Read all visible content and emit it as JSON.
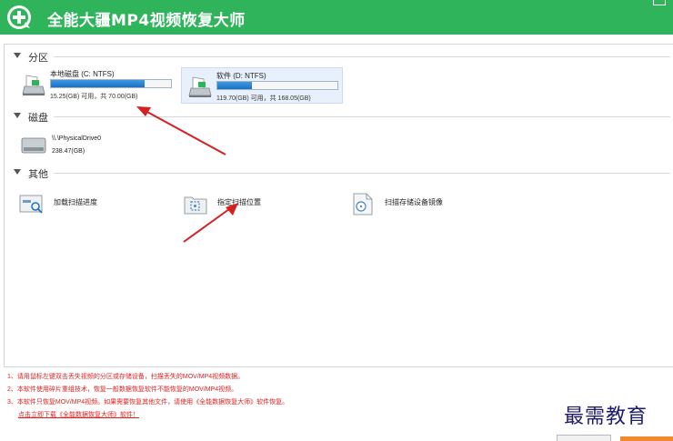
{
  "app": {
    "title": "全能大疆MP4视频恢复大师"
  },
  "sections": {
    "partition": {
      "label": "分区"
    },
    "disk": {
      "label": "磁盘"
    },
    "other": {
      "label": "其他"
    }
  },
  "partitions": [
    {
      "name": "本地磁盘 (C: NTFS)",
      "usage": "15.25(GB) 可用，共 70.00(GB)",
      "used_fraction": 0.78
    },
    {
      "name": "软件 (D: NTFS)",
      "usage": "119.70(GB) 可用，共 168.05(GB)",
      "used_fraction": 0.29
    }
  ],
  "disks": [
    {
      "name": "\\\\.\\PhysicalDrive0",
      "size": "238.47(GB)"
    }
  ],
  "others": [
    {
      "label": "加载扫描进度",
      "icon": "load-scan-icon"
    },
    {
      "label": "指定扫描位置",
      "icon": "scan-location-icon"
    },
    {
      "label": "扫描存储设备镜像",
      "icon": "device-image-icon"
    }
  ],
  "notes": {
    "line1": "1、请用鼠标左键双击丢失视频的分区或存储设备，扫描丢失的MOV/MP4视频数据。",
    "line2": "2、本软件使用碎片重组技术，恢复一般数据恢复软件不能恢复的MOV/MP4视频。",
    "line3": "3、本软件只恢复MOV/MP4视频。如果需要恢复其他文件，请使用《全能数据恢复大师》软件恢复。",
    "link": "点击立即下载《全能数据恢复大师》软件！"
  },
  "watermark": "最需教育",
  "colors": {
    "titlebar": "#2fb35b",
    "progress": "#1c6fc3",
    "note_red": "#e02020",
    "arrow_red": "#d42020"
  }
}
